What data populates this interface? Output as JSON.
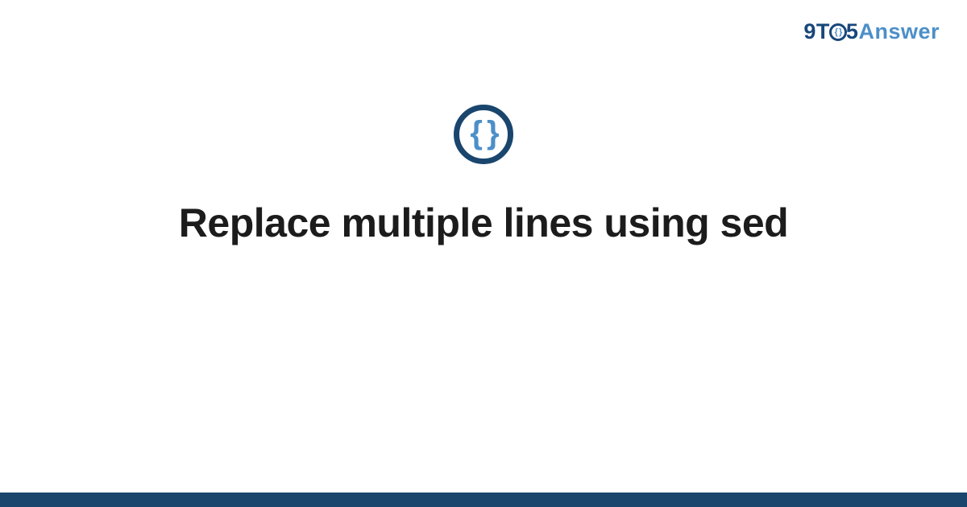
{
  "logo": {
    "part_9": "9",
    "part_T": "T",
    "part_O_brace": "{ }",
    "part_5": "5",
    "part_Answer": "Answer"
  },
  "badge": {
    "glyph": "{ }"
  },
  "title": "Replace multiple lines using sed",
  "colors": {
    "brand_dark": "#1a466e",
    "brand_light": "#4c8fc9"
  }
}
